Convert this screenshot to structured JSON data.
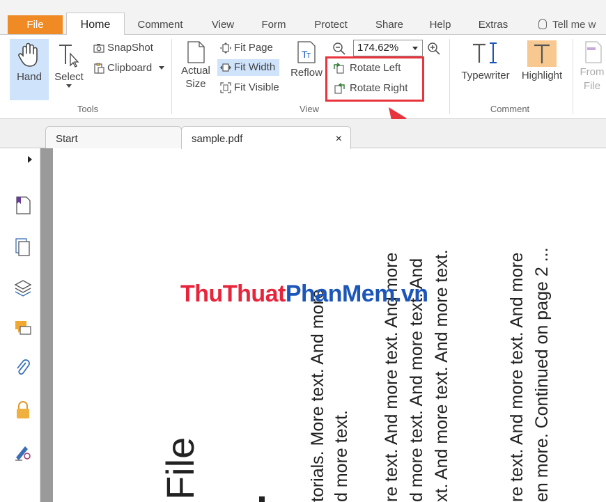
{
  "menu_tabs": {
    "file": "File",
    "home": "Home",
    "comment": "Comment",
    "view": "View",
    "form": "Form",
    "protect": "Protect",
    "share": "Share",
    "help": "Help",
    "extras": "Extras",
    "tell_me": "Tell me w"
  },
  "ribbon": {
    "tools": {
      "hand": "Hand",
      "select": "Select",
      "snapshot": "SnapShot",
      "clipboard": "Clipboard",
      "label": "Tools"
    },
    "view": {
      "actual_size_line1": "Actual",
      "actual_size_line2": "Size",
      "fit_page": "Fit Page",
      "fit_width": "Fit Width",
      "fit_visible": "Fit Visible",
      "reflow": "Reflow",
      "zoom_value": "174.62%",
      "rotate_left": "Rotate Left",
      "rotate_right": "Rotate Right",
      "label": "View"
    },
    "comment": {
      "typewriter": "Typewriter",
      "highlight": "Highlight",
      "label": "Comment"
    },
    "from_file_line1": "From",
    "from_file_line2": "File"
  },
  "doc_tabs": {
    "start": "Start",
    "sample": "sample.pdf",
    "close": "×"
  },
  "document": {
    "title": "File",
    "col1_line1": "torials. More text. And more",
    "col1_line2": "d more text.",
    "col2_line1": "re text. And more text. And more",
    "col2_line2": "d more text. And more text. And",
    "col2_line3": "xt. And more text. And more text.",
    "col3_line1": "re text. And more text. And more",
    "col3_line2": "en more. Continued on page 2 ..."
  },
  "watermark": {
    "part1": "ThuThuat",
    "part2": "PhanMem",
    "part3": ".vn"
  },
  "colors": {
    "accent_file": "#f08a24",
    "highlight_box": "#e8343d",
    "selected_bg": "#cfe3fb"
  }
}
